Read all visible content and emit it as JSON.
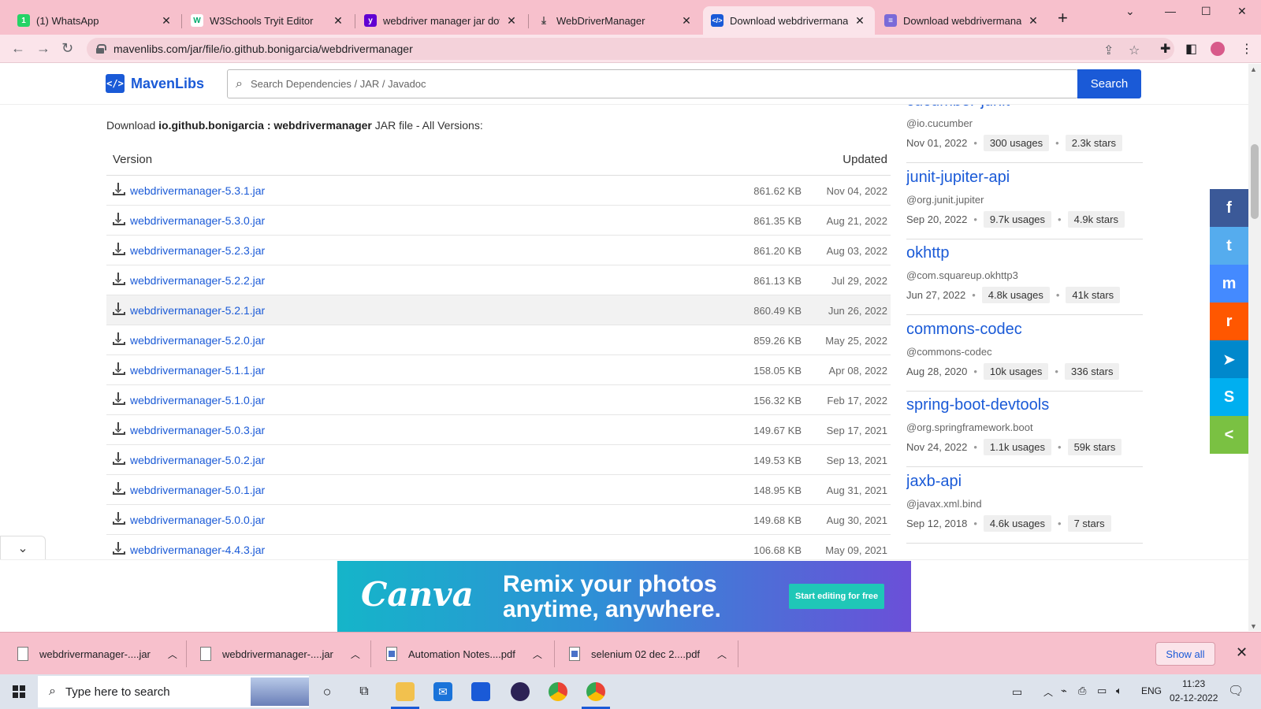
{
  "browser": {
    "tabs": [
      {
        "title": "(1) WhatsApp",
        "fav_color": "#25d366",
        "icon": "whatsapp-icon"
      },
      {
        "title": "W3Schools Tryit Editor",
        "fav_color": "#04aa6d",
        "icon": "w3schools-icon"
      },
      {
        "title": "webdriver manager jar downl",
        "fav_color": "#6001d2",
        "icon": "yahoo-icon"
      },
      {
        "title": "WebDriverManager",
        "fav_color": "#555555",
        "icon": "download-icon"
      },
      {
        "title": "Download webdrivermanager",
        "fav_color": "#1a5ad7",
        "icon": "mavenlibs-icon"
      },
      {
        "title": "Download webdrivermanager",
        "fav_color": "#7a6ad8",
        "icon": "document-icon"
      }
    ],
    "url": "mavenlibs.com/jar/file/io.github.bonigarcia/webdrivermanager"
  },
  "site": {
    "logo": "MavenLibs",
    "search_placeholder": "Search Dependencies / JAR / Javadoc",
    "search_button": "Search"
  },
  "main": {
    "intro_prefix": "Download ",
    "intro_artifact": "io.github.bonigarcia : webdrivermanager",
    "intro_suffix": " JAR file - All Versions:",
    "col_version": "Version",
    "col_updated": "Updated",
    "rows": [
      {
        "name": "webdrivermanager-5.3.1.jar",
        "size": "861.62 KB",
        "date": "Nov 04, 2022"
      },
      {
        "name": "webdrivermanager-5.3.0.jar",
        "size": "861.35 KB",
        "date": "Aug 21, 2022"
      },
      {
        "name": "webdrivermanager-5.2.3.jar",
        "size": "861.20 KB",
        "date": "Aug 03, 2022"
      },
      {
        "name": "webdrivermanager-5.2.2.jar",
        "size": "861.13 KB",
        "date": "Jul 29, 2022"
      },
      {
        "name": "webdrivermanager-5.2.1.jar",
        "size": "860.49 KB",
        "date": "Jun 26, 2022"
      },
      {
        "name": "webdrivermanager-5.2.0.jar",
        "size": "859.26 KB",
        "date": "May 25, 2022"
      },
      {
        "name": "webdrivermanager-5.1.1.jar",
        "size": "158.05 KB",
        "date": "Apr 08, 2022"
      },
      {
        "name": "webdrivermanager-5.1.0.jar",
        "size": "156.32 KB",
        "date": "Feb 17, 2022"
      },
      {
        "name": "webdrivermanager-5.0.3.jar",
        "size": "149.67 KB",
        "date": "Sep 17, 2021"
      },
      {
        "name": "webdrivermanager-5.0.2.jar",
        "size": "149.53 KB",
        "date": "Sep 13, 2021"
      },
      {
        "name": "webdrivermanager-5.0.1.jar",
        "size": "148.95 KB",
        "date": "Aug 31, 2021"
      },
      {
        "name": "webdrivermanager-5.0.0.jar",
        "size": "149.68 KB",
        "date": "Aug 30, 2021"
      },
      {
        "name": "webdrivermanager-4.4.3.jar",
        "size": "106.68 KB",
        "date": "May 09, 2021"
      }
    ]
  },
  "sidebar": {
    "packages": [
      {
        "name": "cucumber-junit",
        "group": "@io.cucumber",
        "date": "Nov 01, 2022",
        "usages": "300 usages",
        "stars": "2.3k stars"
      },
      {
        "name": "junit-jupiter-api",
        "group": "@org.junit.jupiter",
        "date": "Sep 20, 2022",
        "usages": "9.7k usages",
        "stars": "4.9k stars"
      },
      {
        "name": "okhttp",
        "group": "@com.squareup.okhttp3",
        "date": "Jun 27, 2022",
        "usages": "4.8k usages",
        "stars": "41k stars"
      },
      {
        "name": "commons-codec",
        "group": "@commons-codec",
        "date": "Aug 28, 2020",
        "usages": "10k usages",
        "stars": "336 stars"
      },
      {
        "name": "spring-boot-devtools",
        "group": "@org.springframework.boot",
        "date": "Nov 24, 2022",
        "usages": "1.1k usages",
        "stars": "59k stars"
      },
      {
        "name": "jaxb-api",
        "group": "@javax.xml.bind",
        "date": "Sep 12, 2018",
        "usages": "4.6k usages",
        "stars": "7 stars"
      }
    ]
  },
  "share": [
    {
      "icon": "facebook-icon",
      "glyph": "f",
      "color": "#3b5998"
    },
    {
      "icon": "twitter-icon",
      "glyph": "t",
      "color": "#55acee"
    },
    {
      "icon": "messenger-icon",
      "glyph": "m",
      "color": "#448aff"
    },
    {
      "icon": "reddit-icon",
      "glyph": "r",
      "color": "#ff5700"
    },
    {
      "icon": "telegram-icon",
      "glyph": "➤",
      "color": "#0088cc"
    },
    {
      "icon": "skype-icon",
      "glyph": "S",
      "color": "#00aff0"
    },
    {
      "icon": "share-icon",
      "glyph": "<",
      "color": "#7ac142"
    }
  ],
  "ad": {
    "brand": "Canva",
    "line1": "Remix your photos",
    "line2": "anytime, anywhere.",
    "cta": "Start editing for free"
  },
  "downloads": {
    "items": [
      {
        "name": "webdrivermanager-....jar",
        "type": "jar"
      },
      {
        "name": "webdrivermanager-....jar",
        "type": "jar"
      },
      {
        "name": "Automation Notes....pdf",
        "type": "pdf"
      },
      {
        "name": "selenium 02 dec 2....pdf",
        "type": "pdf"
      }
    ],
    "show_all": "Show all"
  },
  "taskbar": {
    "search_placeholder": "Type here to search",
    "lang": "ENG",
    "time": "11:23",
    "date": "02-12-2022"
  }
}
